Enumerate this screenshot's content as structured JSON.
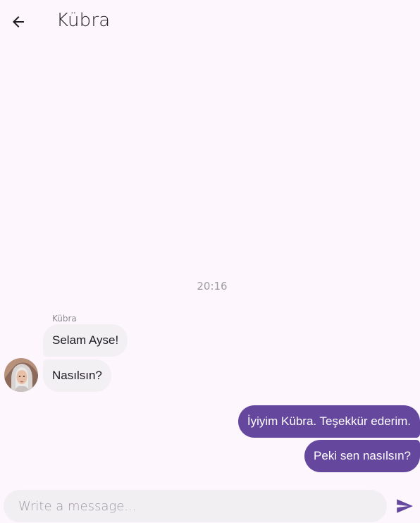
{
  "header": {
    "back_icon": "arrow-left-icon",
    "title": "Kübra"
  },
  "chat": {
    "timestamp": "20:16",
    "incoming": {
      "sender": "Kübra",
      "avatar_icon": "user-avatar",
      "messages": [
        "Selam Ayse!",
        "Nasılsın?"
      ]
    },
    "outgoing": {
      "messages": [
        "İyiyim Kübra. Teşekkür ederim.",
        "Peki sen nasılsın?"
      ]
    }
  },
  "composer": {
    "placeholder": "Write a message...",
    "value": "",
    "send_icon": "send-icon"
  },
  "colors": {
    "background": "#FDF6FD",
    "incoming_bubble": "#F3F0F3",
    "outgoing_bubble": "#65489E",
    "accent": "#65489E"
  }
}
